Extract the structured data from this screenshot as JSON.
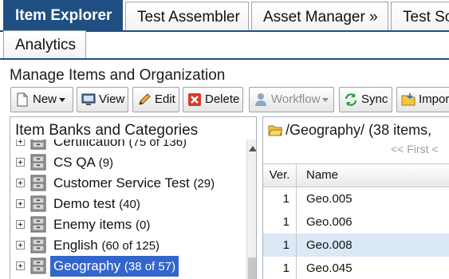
{
  "tabs": [
    {
      "label": "Item Explorer",
      "active": true
    },
    {
      "label": "Test Assembler",
      "active": false
    },
    {
      "label": "Asset Manager »",
      "active": false
    },
    {
      "label": "Test Sc",
      "active": false
    }
  ],
  "tab_row2": [
    {
      "label": "Analytics",
      "active": false
    }
  ],
  "colors": {
    "accent": "#1f4f82",
    "selection": "#3366cc",
    "alt_row": "#dbe8f6"
  },
  "section_title": "Manage Items and Organization",
  "toolbar": {
    "new": {
      "label": "New",
      "icon": "new-document-icon"
    },
    "view": {
      "label": "View",
      "icon": "monitor-icon"
    },
    "edit": {
      "label": "Edit",
      "icon": "pencil-icon"
    },
    "delete": {
      "label": "Delete",
      "icon": "delete-x-icon"
    },
    "workflow": {
      "label": "Workflow",
      "icon": "user-icon",
      "disabled": true
    },
    "sync": {
      "label": "Sync",
      "icon": "sync-arrows-icon"
    },
    "import": {
      "label": "Impor",
      "icon": "import-folder-icon"
    }
  },
  "left_panel": {
    "header": "Item Banks and Categories",
    "nodes": [
      {
        "name": "Certification",
        "count": "(75 of 136)",
        "selected": false
      },
      {
        "name": "CS QA",
        "count": "(9)",
        "selected": false
      },
      {
        "name": "Customer Service Test",
        "count": "(29)",
        "selected": false
      },
      {
        "name": "Demo test",
        "count": "(40)",
        "selected": false
      },
      {
        "name": "Enemy items",
        "count": "(0)",
        "selected": false
      },
      {
        "name": "English",
        "count": "(60 of 125)",
        "selected": false
      },
      {
        "name": "Geography",
        "count": "(38 of 57)",
        "selected": true
      }
    ]
  },
  "right_panel": {
    "path": "/Geography/ (38 items,",
    "pager_first": "<< First  <",
    "columns": {
      "ver": "Ver.",
      "name": "Name"
    },
    "rows": [
      {
        "ver": "1",
        "name": "Geo.005"
      },
      {
        "ver": "1",
        "name": "Geo.006"
      },
      {
        "ver": "1",
        "name": "Geo.008"
      },
      {
        "ver": "1",
        "name": "Geo.045"
      }
    ]
  }
}
